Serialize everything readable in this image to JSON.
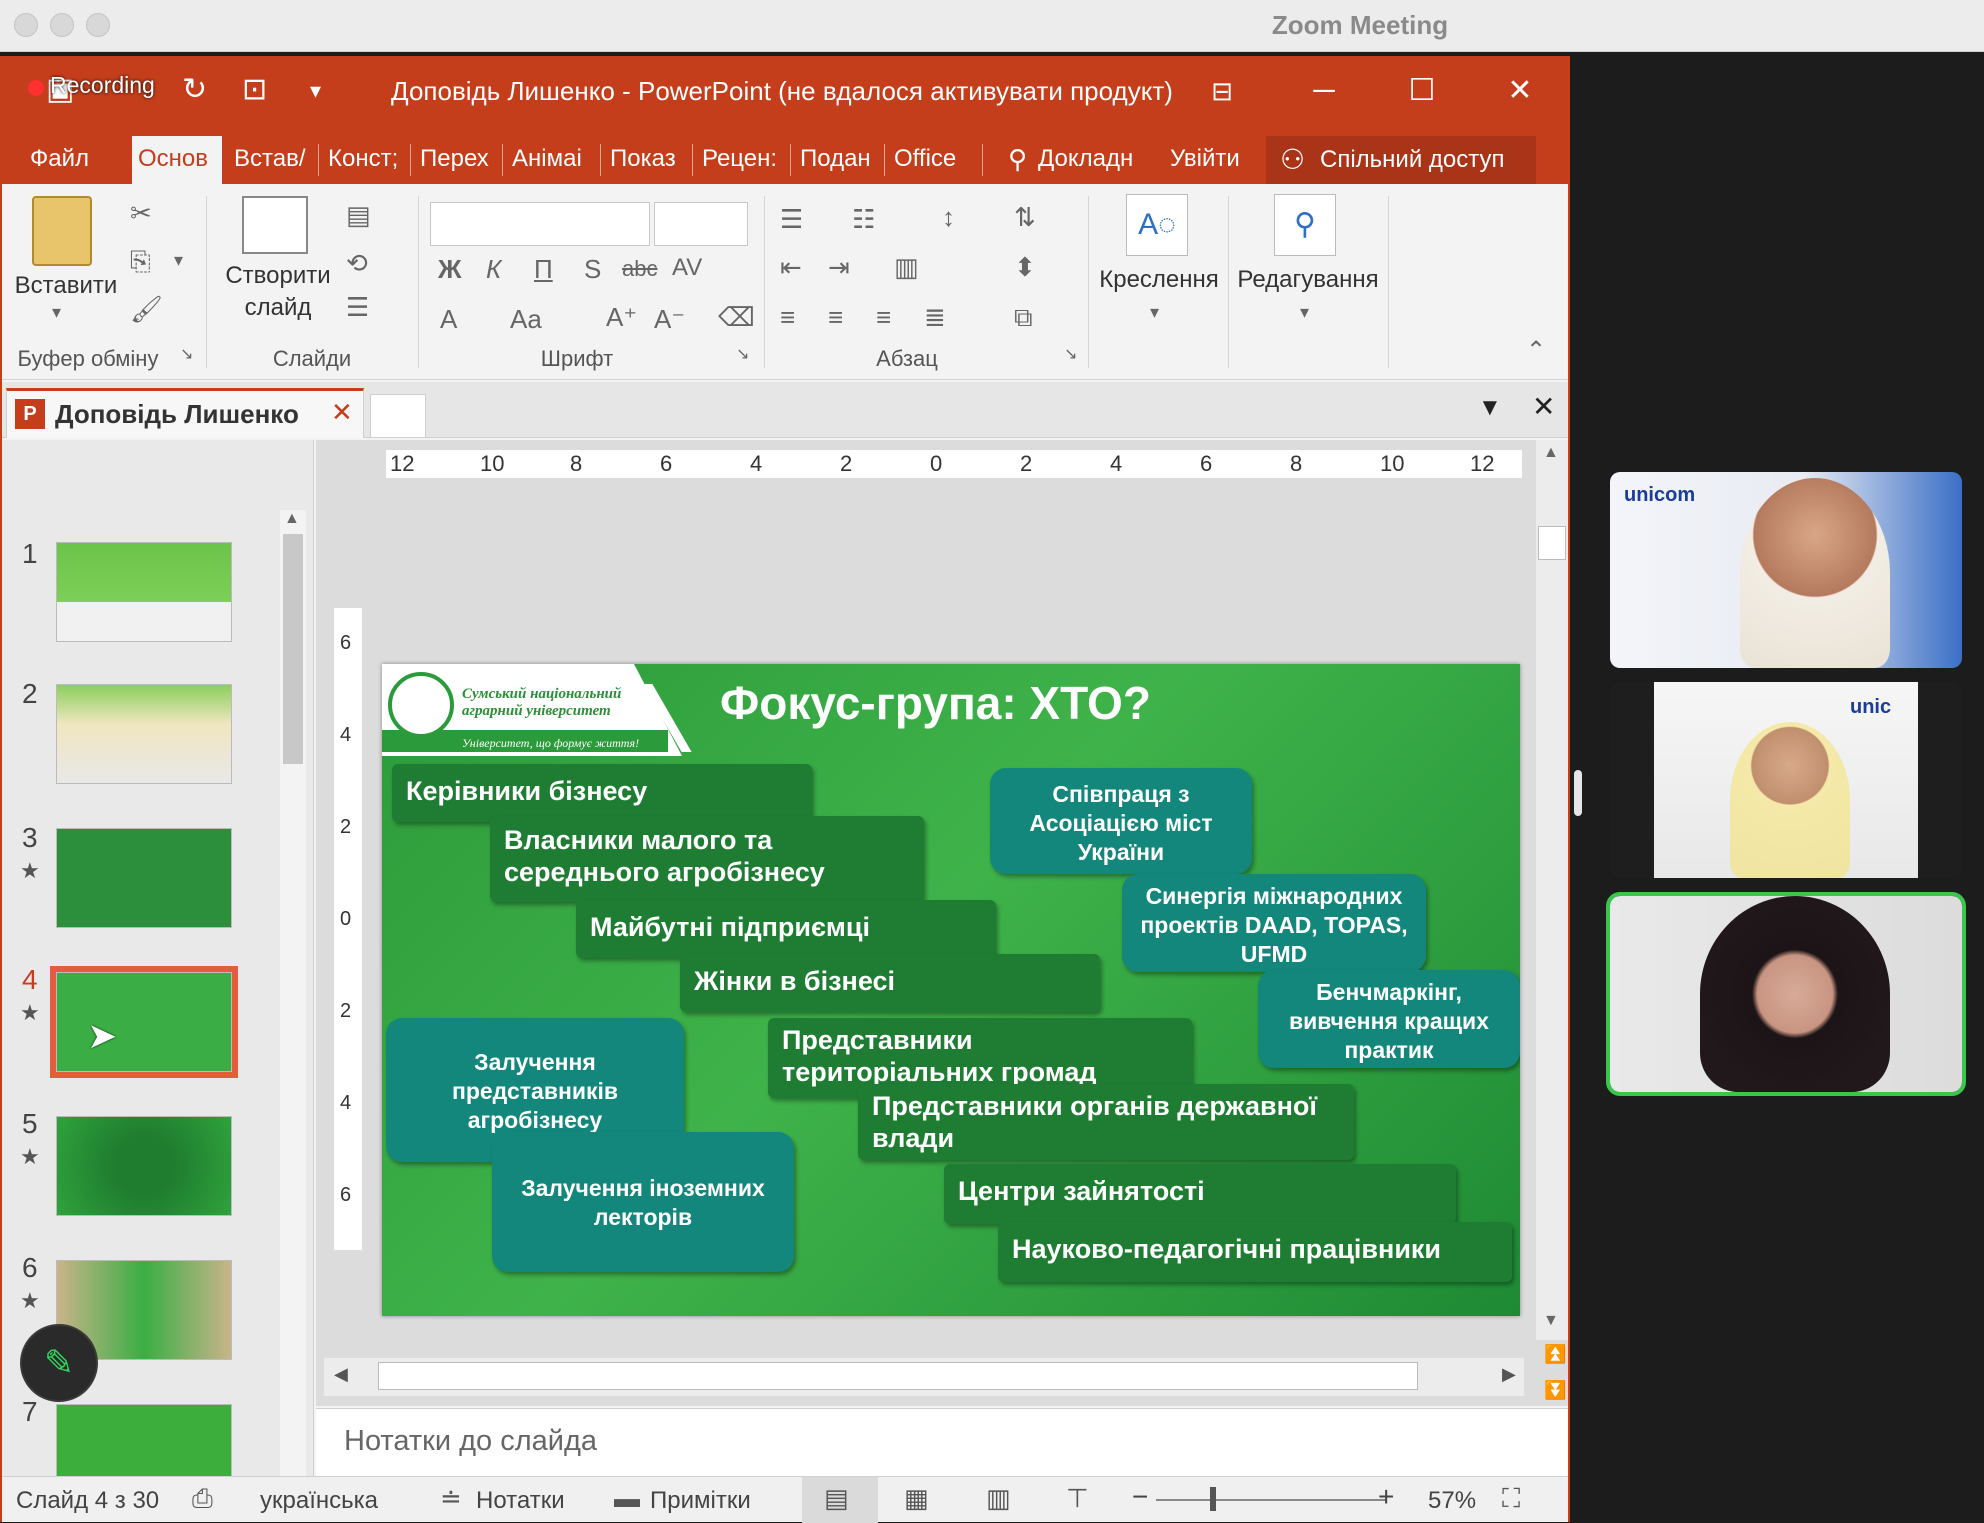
{
  "zoom": {
    "window_title": "Zoom Meeting",
    "recording_label": "Recording"
  },
  "powerpoint": {
    "title": "Доповідь Лишенко - PowerPoint (не вдалося активувати продукт)",
    "tabs": [
      "Файл",
      "Основ",
      "Встав/",
      "Конст;",
      "Перех",
      "Анімаі",
      "Показ",
      "Рецен:",
      "Подан",
      "Office"
    ],
    "tell_me": "Докладн",
    "sign_in": "Увійти",
    "share": "Спільний доступ",
    "ribbon": {
      "paste": "Вставити",
      "new_slide_line1": "Створити",
      "new_slide_line2": "слайд",
      "drawing": "Креслення",
      "editing": "Редагування",
      "groups": {
        "clipboard": "Буфер обміну",
        "slides": "Слайди",
        "font": "Шрифт",
        "paragraph": "Абзац"
      },
      "font_buttons": [
        "Ж",
        "К",
        "П",
        "S",
        "abc",
        "AV"
      ]
    },
    "document_tab": "Доповідь Лишенко",
    "ruler_labels": [
      "12",
      "10",
      "8",
      "6",
      "4",
      "2",
      "0",
      "2",
      "4",
      "6",
      "8",
      "10",
      "12"
    ],
    "vruler_labels": [
      "6",
      "4",
      "2",
      "0",
      "2",
      "4",
      "6"
    ],
    "thumbnails": [
      {
        "num": "1",
        "star": ""
      },
      {
        "num": "2",
        "star": ""
      },
      {
        "num": "3",
        "star": "★"
      },
      {
        "num": "4",
        "star": "★"
      },
      {
        "num": "5",
        "star": "★"
      },
      {
        "num": "6",
        "star": "★"
      },
      {
        "num": "7",
        "star": ""
      }
    ],
    "slide": {
      "logo_line1": "Сумський національний",
      "logo_line2": "аграрний університет",
      "logo_tagline": "Університет, що формує життя!",
      "title": "Фокус-група: ХТО?",
      "dark_boxes": [
        "Керівники бізнесу",
        "Власники малого та середнього агробізнесу",
        "Майбутні підприємці",
        "Жінки в бізнесі",
        "Представники територіальних громад",
        "Представники органів державної влади",
        "Центри зайнятості",
        "Науково-педагогічні працівники"
      ],
      "teal_boxes": [
        "Співпраця з Асоціацією міст України",
        "Синергія міжнародних проектів DAAD, TOPAS, UFMD",
        "Бенчмаркінг, вивчення кращих практик",
        "Залучення представників агробізнесу",
        "Залучення іноземних лекторів"
      ]
    },
    "notes_placeholder": "Нотатки до слайда",
    "status": {
      "slide_of": "Слайд 4 з 30",
      "language": "українська",
      "notes": "Нотатки",
      "comments": "Примітки",
      "zoom": "57%"
    }
  },
  "participants": [
    {
      "logo": "unicom",
      "active": false
    },
    {
      "logo": "unic",
      "active": false
    },
    {
      "logo": "",
      "active": true
    }
  ],
  "colors": {
    "ppt_accent": "#c43e1c",
    "slide_green": "#3fb34a",
    "dark_box": "#1e7d33",
    "teal_box": "#14877c",
    "active_speaker": "#3ac64d"
  }
}
